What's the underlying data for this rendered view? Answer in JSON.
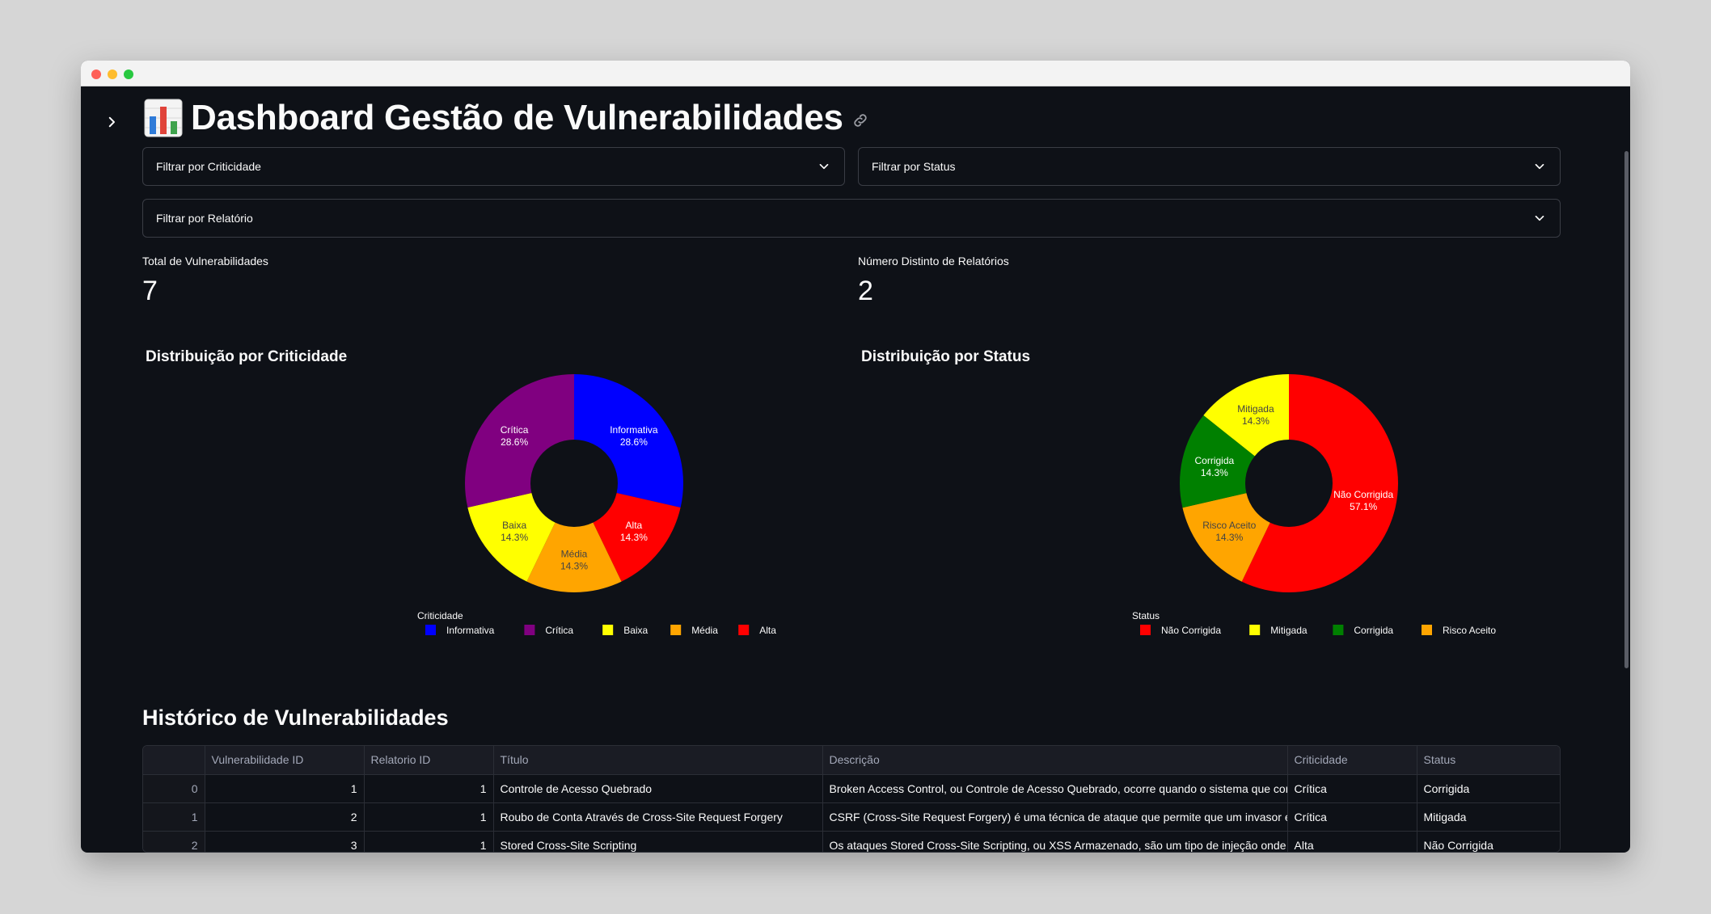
{
  "page": {
    "title": "Dashboard Gestão de Vulnerabilidades",
    "title_icon": "bar-chart-emoji"
  },
  "filters": {
    "criticidade": "Filtrar por Criticidade",
    "status": "Filtrar por Status",
    "relatorio": "Filtrar por Relatório"
  },
  "metrics": {
    "total_label": "Total de Vulnerabilidades",
    "total_value": "7",
    "relatorios_label": "Número Distinto de Relatórios",
    "relatorios_value": "2"
  },
  "chart_data": [
    {
      "type": "pie",
      "title": "Distribuição por Criticidade",
      "legend_title": "Criticidade",
      "legend_placement": "bottom",
      "hole": 0.4,
      "slices": [
        {
          "label": "Informativa",
          "value": 28.6,
          "text": "28.6%",
          "color": "#0000ff",
          "text_color": "#ffffff"
        },
        {
          "label": "Alta",
          "value": 14.3,
          "text": "14.3%",
          "color": "#ff0000",
          "text_color": "#ffffff"
        },
        {
          "label": "Média",
          "value": 14.3,
          "text": "14.3%",
          "color": "#ffa500",
          "text_color": "#444444"
        },
        {
          "label": "Baixa",
          "value": 14.3,
          "text": "14.3%",
          "color": "#ffff00",
          "text_color": "#444444"
        },
        {
          "label": "Crítica",
          "value": 28.6,
          "text": "28.6%",
          "color": "#800080",
          "text_color": "#ffffff"
        }
      ],
      "legend": [
        {
          "label": "Informativa",
          "color": "#0000ff"
        },
        {
          "label": "Crítica",
          "color": "#800080"
        },
        {
          "label": "Baixa",
          "color": "#ffff00"
        },
        {
          "label": "Média",
          "color": "#ffa500"
        },
        {
          "label": "Alta",
          "color": "#ff0000"
        }
      ]
    },
    {
      "type": "pie",
      "title": "Distribuição por Status",
      "legend_title": "Status",
      "legend_placement": "bottom",
      "hole": 0.4,
      "slices": [
        {
          "label": "Não Corrigida",
          "value": 57.1,
          "text": "57.1%",
          "color": "#ff0000",
          "text_color": "#ffffff"
        },
        {
          "label": "Risco Aceito",
          "value": 14.3,
          "text": "14.3%",
          "color": "#ffa500",
          "text_color": "#444444"
        },
        {
          "label": "Corrigida",
          "value": 14.3,
          "text": "14.3%",
          "color": "#008000",
          "text_color": "#ffffff"
        },
        {
          "label": "Mitigada",
          "value": 14.3,
          "text": "14.3%",
          "color": "#ffff00",
          "text_color": "#444444"
        }
      ],
      "legend": [
        {
          "label": "Não Corrigida",
          "color": "#ff0000"
        },
        {
          "label": "Mitigada",
          "color": "#ffff00"
        },
        {
          "label": "Corrigida",
          "color": "#008000"
        },
        {
          "label": "Risco Aceito",
          "color": "#ffa500"
        }
      ]
    }
  ],
  "history": {
    "title": "Histórico de Vulnerabilidades",
    "columns": [
      "",
      "Vulnerabilidade ID",
      "Relatorio ID",
      "Título",
      "Descrição",
      "Criticidade",
      "Status"
    ],
    "rows": [
      [
        "0",
        "1",
        "1",
        "Controle de Acesso Quebrado",
        "Broken Access Control, ou Controle de Acesso Quebrado, ocorre quando o sistema que controla as",
        "Crítica",
        "Corrigida"
      ],
      [
        "1",
        "2",
        "1",
        "Roubo de Conta Através de Cross-Site Request Forgery",
        "CSRF (Cross-Site Request Forgery) é uma técnica de ataque que permite que um invasor execute a",
        "Crítica",
        "Mitigada"
      ],
      [
        "2",
        "3",
        "1",
        "Stored Cross-Site Scripting",
        "Os ataques Stored Cross-Site Scripting, ou XSS Armazenado, são um tipo de injeção onde scripts m",
        "Alta",
        "Não Corrigida"
      ]
    ]
  }
}
